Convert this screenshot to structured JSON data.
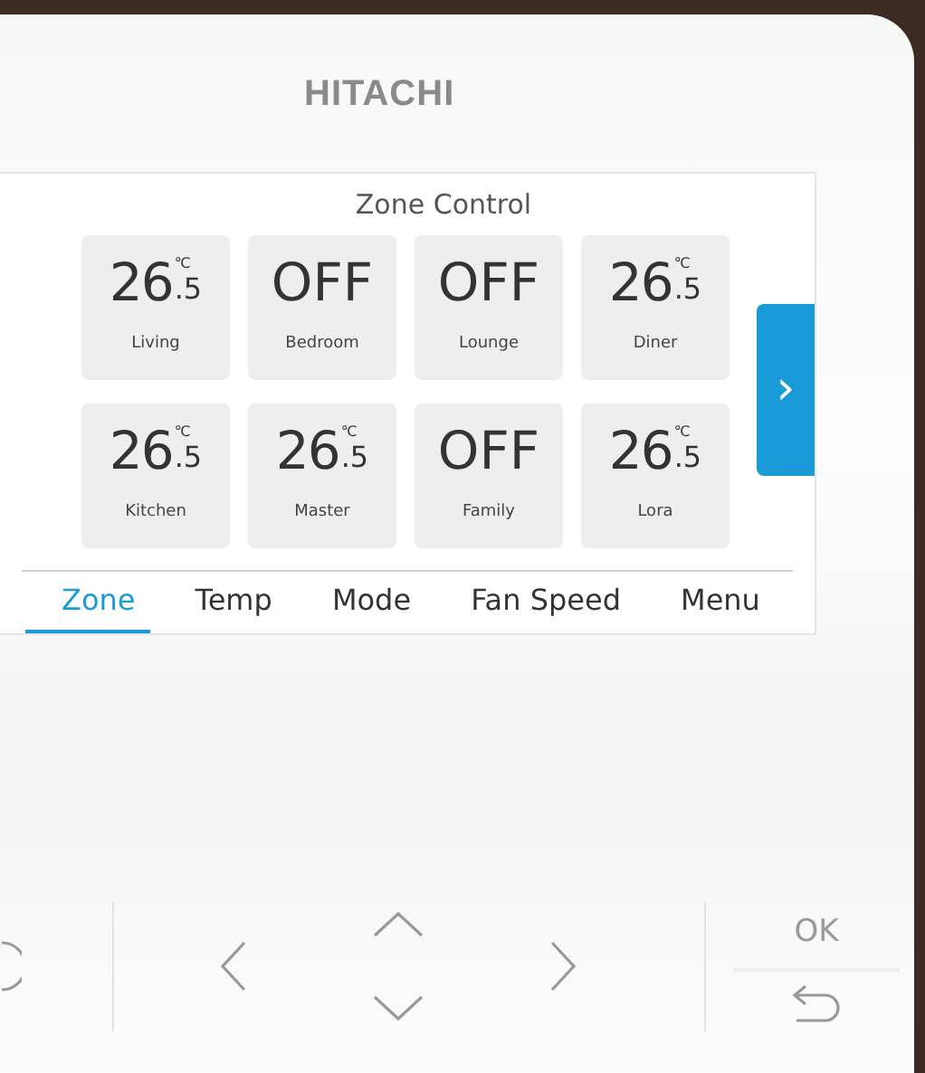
{
  "logo": "HITACHI",
  "screen": {
    "title": "Zone Control",
    "zones": [
      {
        "kind": "temp",
        "whole": "26",
        "fraction": ".5",
        "unit": "℃",
        "name": "Living"
      },
      {
        "kind": "off",
        "state_text": "OFF",
        "name": "Bedroom"
      },
      {
        "kind": "off",
        "state_text": "OFF",
        "name": "Lounge"
      },
      {
        "kind": "temp",
        "whole": "26",
        "fraction": ".5",
        "unit": "℃",
        "name": "Diner"
      },
      {
        "kind": "temp",
        "whole": "26",
        "fraction": ".5",
        "unit": "℃",
        "name": "Kitchen"
      },
      {
        "kind": "temp",
        "whole": "26",
        "fraction": ".5",
        "unit": "℃",
        "name": "Master"
      },
      {
        "kind": "off",
        "state_text": "OFF",
        "name": "Family"
      },
      {
        "kind": "temp",
        "whole": "26",
        "fraction": ".5",
        "unit": "℃",
        "name": "Lora"
      }
    ],
    "next_tab": "›",
    "tabs": [
      {
        "label": "Zone",
        "selected": true
      },
      {
        "label": "Temp",
        "selected": false
      },
      {
        "label": "Mode",
        "selected": false
      },
      {
        "label": "Fan Speed",
        "selected": false
      },
      {
        "label": "Menu",
        "selected": false
      }
    ]
  },
  "keys": {
    "ok": "OK"
  }
}
